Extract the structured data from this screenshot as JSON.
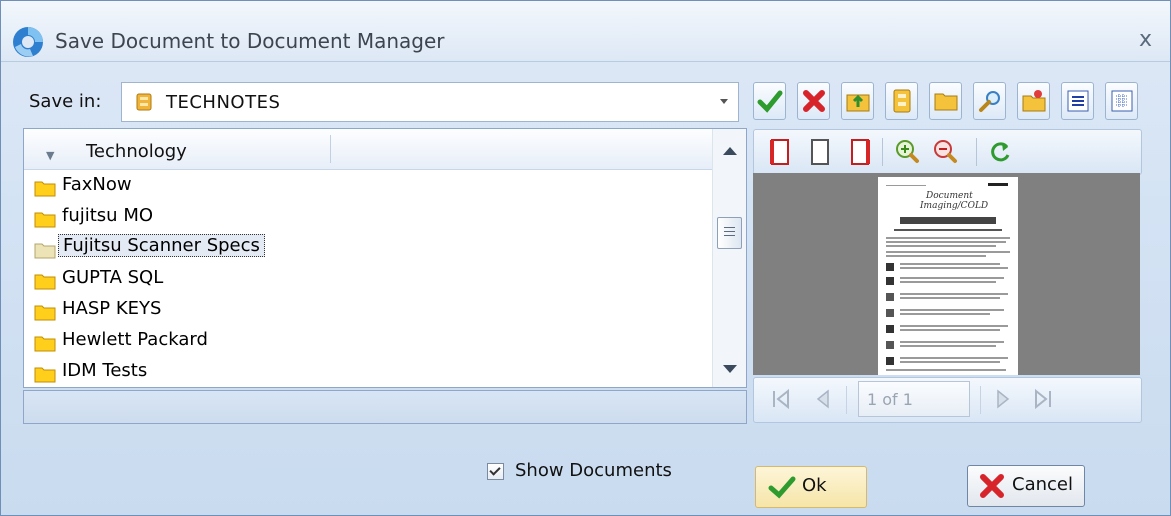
{
  "window": {
    "title": "Save Document to Document Manager",
    "close_glyph": "x"
  },
  "save_in": {
    "label": "Save in:",
    "value": "TECHNOTES"
  },
  "toolbar": {
    "icons": [
      "check-icon",
      "delete-x-icon",
      "folder-up-icon",
      "cabinet-icon",
      "folder-icon",
      "search-icon",
      "new-folder-icon",
      "list-view-icon",
      "detail-view-icon"
    ]
  },
  "tree": {
    "header": "Technology",
    "items": [
      {
        "label": "FaxNow"
      },
      {
        "label": "fujitsu MO"
      },
      {
        "label": "Fujitsu Scanner Specs",
        "selected": true
      },
      {
        "label": "GUPTA SQL"
      },
      {
        "label": "HASP KEYS"
      },
      {
        "label": "Hewlett Packard"
      },
      {
        "label": "IDM Tests"
      }
    ]
  },
  "preview": {
    "page_title_lines": [
      "Document",
      "Imaging/COLD"
    ],
    "nav": {
      "page_text": "1 of 1"
    }
  },
  "show_documents": {
    "label": "Show Documents",
    "checked": true
  },
  "buttons": {
    "ok": "Ok",
    "cancel": "Cancel"
  },
  "colors": {
    "accent": "#2f7fd0",
    "dialog_bg": "#d4e3f4",
    "selected_row": "#e4eaf3"
  }
}
